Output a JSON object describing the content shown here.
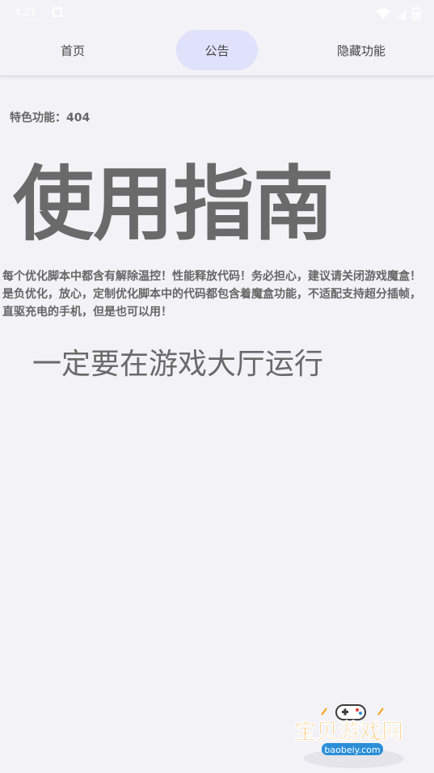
{
  "status_bar": {
    "time": "4:21",
    "icons": [
      "notification-icon",
      "wifi-icon",
      "signal-icon",
      "battery-icon"
    ]
  },
  "tabs": [
    {
      "label": "首页",
      "selected": false
    },
    {
      "label": "公告",
      "selected": true
    },
    {
      "label": "隐藏功能",
      "selected": false
    }
  ],
  "content": {
    "feature_line": "特色功能：404",
    "guide_title": "使用指南",
    "description": "每个优化脚本中都含有解除温控！性能释放代码！务必担心，建议请关闭游戏魔盒！是负优化，放心，定制优化脚本中的代码都包含着魔盒功能，不适配支持超分插帧，直驱充电的手机，但是也可以用！",
    "must_line": "一定要在游戏大厅运行"
  },
  "watermark": {
    "name": "宝贝游戏网",
    "url": "baobeiy.com"
  },
  "colors": {
    "background": "#f3f2f7",
    "selected_tab_pill": "#e0e1fb",
    "text": "#6a6a6a",
    "watermark_orange": "#f5a21b",
    "watermark_blue": "#2a8fd8"
  }
}
